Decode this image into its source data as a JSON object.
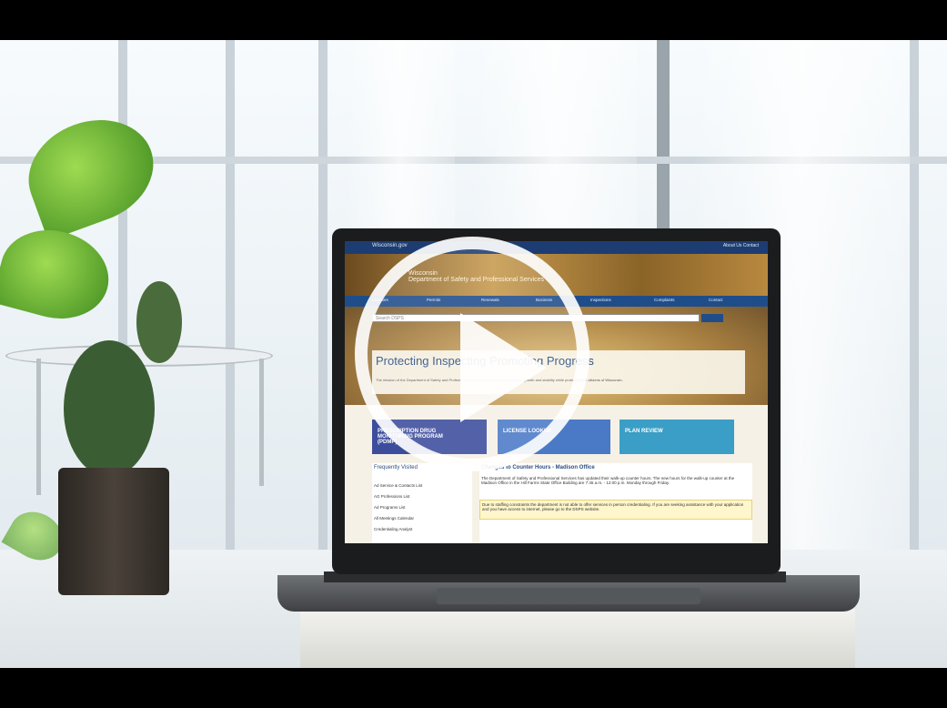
{
  "video": {
    "play_label": "",
    "play_icon": "play-icon"
  },
  "site": {
    "brand": "Wisconsin.gov",
    "top_links": "About Us   Contact",
    "banner_line1": "Wisconsin",
    "banner_line2": "Department of Safety and Professional Services",
    "nav": [
      "Licenses",
      "Permits",
      "Renewals",
      "Business",
      "Inspections",
      "Complaints",
      "Contact"
    ],
    "search_placeholder": "Search DSPS",
    "hero_title": "Protecting Inspecting Promoting Progress",
    "hero_text": "The mission of the Department of Safety and Professional Services is to promote economic growth and stability while protecting the citizens of Wisconsin.",
    "tiles": [
      {
        "label": "PRESCRIPTION DRUG MONITORING PROGRAM (PDMP)",
        "color": "#3c4d9c"
      },
      {
        "label": "LICENSE LOOKUP",
        "color": "#4a7ac6"
      },
      {
        "label": "PLAN REVIEW",
        "color": "#3a9ec6"
      }
    ],
    "left_heading": "Frequently Visited",
    "left_links": [
      "Ad Service & Contacts List",
      "AG Professions List",
      "Ad Programs List",
      "All Meetings Calendar",
      "Credentialing Analyst"
    ],
    "right_heading": "Changes to Counter Hours - Madison Office",
    "right_text": "The Department of Safety and Professional Services has updated their walk-up counter hours. The new hours for the walk-up counter at the Madison Office in the Hill Farms State Office Building are 7:45 a.m. - 12:00 p.m. Monday through Friday.",
    "notice_text": "Due to staffing constraints the department is not able to offer services in person credentialing. If you are seeking assistance with your application and you have access to internet, please go to the DSPS website."
  }
}
